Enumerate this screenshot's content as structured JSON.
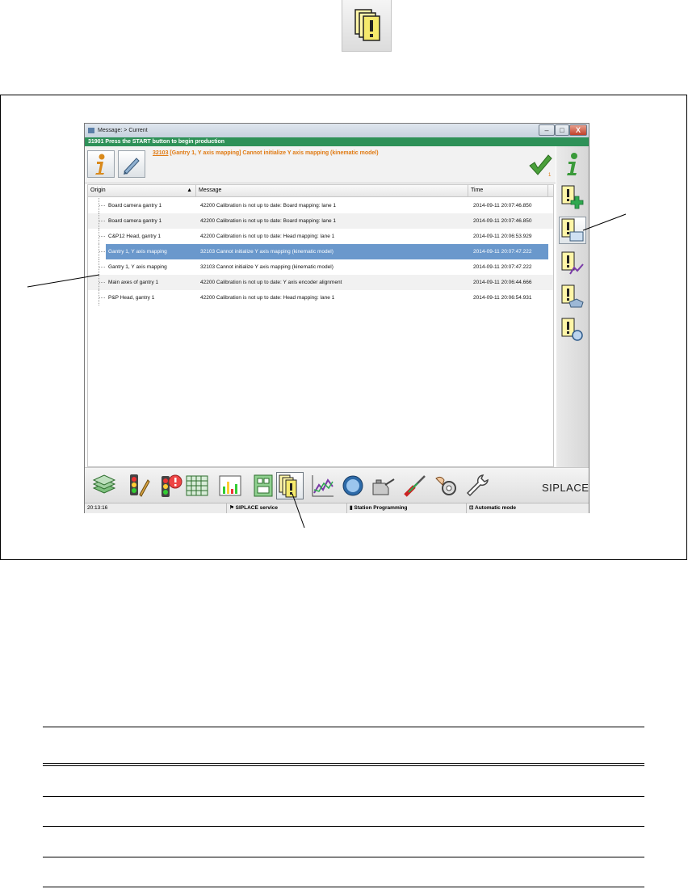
{
  "window": {
    "title": "Message: > Current",
    "minimize": "–",
    "maximize": "□",
    "close": "X"
  },
  "status_line": "31901 Press the START button to begin production",
  "current_message": {
    "code": "32103",
    "text": " [Gantry 1, Y axis mapping] Cannot initialize Y axis mapping (kinematic model)",
    "ack_count": "1"
  },
  "list": {
    "columns": {
      "origin": "Origin",
      "message": "Message",
      "time": "Time"
    },
    "sort_indicator": "▲",
    "rows": [
      {
        "origin": "Board camera gantry 1",
        "message": "42200 Calibration is not up to date: Board mapping: lane 1",
        "time": "2014-09-11 20:07:46.850"
      },
      {
        "origin": "Board camera gantry 1",
        "message": "42200 Calibration is not up to date: Board mapping: lane 1",
        "time": "2014-09-11 20:07:46.850"
      },
      {
        "origin": "C&P12 Head, gantry 1",
        "message": "42200 Calibration is not up to date: Head mapping: lane 1",
        "time": "2014-09-11 20:06:53.929"
      },
      {
        "origin": "Gantry 1, Y axis mapping",
        "message": "32103 Cannot initialize Y axis mapping (kinematic model)",
        "time": "2014-09-11 20:07:47.222"
      },
      {
        "origin": "Gantry 1, Y axis mapping",
        "message": "32103 Cannot initialize Y axis mapping (kinematic model)",
        "time": "2014-09-11 20:07:47.222"
      },
      {
        "origin": "Main axes of gantry 1",
        "message": "42200 Calibration is not up to date: Y axis encoder alignment",
        "time": "2014-09-11 20:06:44.666"
      },
      {
        "origin": "P&P Head, gantry 1",
        "message": "42200 Calibration is not up to date: Head mapping: lane 1",
        "time": "2014-09-11 20:06:54.931"
      }
    ]
  },
  "brand": "SIPLACE",
  "status_bar": {
    "time": "20:13:16",
    "user": "SIPLACE service",
    "station": "Station Programming",
    "mode": "Automatic mode"
  },
  "colors": {
    "status_green": "#2e9158",
    "message_orange": "#e07a12",
    "selection_blue": "#6a98cc"
  }
}
